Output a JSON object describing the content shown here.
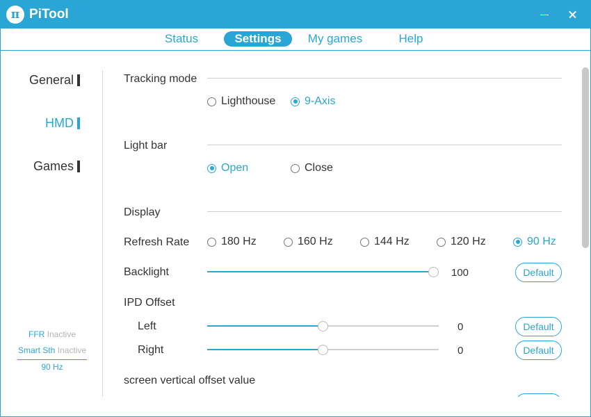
{
  "window": {
    "title": "PiTool",
    "logo_glyph": "π",
    "accent_color": "#2aa6d6"
  },
  "tabs": [
    {
      "label": "Status",
      "active": false
    },
    {
      "label": "Settings",
      "active": true
    },
    {
      "label": "My games",
      "active": false
    },
    {
      "label": "Help",
      "active": false
    }
  ],
  "sidebar": {
    "items": [
      {
        "label": "General",
        "active": false
      },
      {
        "label": "HMD",
        "active": true
      },
      {
        "label": "Games",
        "active": false
      }
    ],
    "status": {
      "ffr_label": "FFR",
      "ffr_value": "Inactive",
      "smart_label": "Smart Sth",
      "smart_value": "Inactive",
      "rate": "90 Hz"
    }
  },
  "settings": {
    "tracking": {
      "title": "Tracking mode",
      "options": [
        "Lighthouse",
        "9-Axis"
      ],
      "selected": "9-Axis"
    },
    "lightbar": {
      "title": "Light bar",
      "options": [
        "Open",
        "Close"
      ],
      "selected": "Open"
    },
    "display": {
      "title": "Display",
      "refresh_label": "Refresh Rate",
      "refresh_options": [
        "180 Hz",
        "160 Hz",
        "144 Hz",
        "120 Hz",
        "90 Hz"
      ],
      "refresh_selected": "90 Hz",
      "backlight_label": "Backlight",
      "backlight_value": "100",
      "backlight_fraction": 1.0,
      "default_label": "Default"
    },
    "ipd": {
      "title": "IPD Offset",
      "left_label": "Left",
      "left_value": "0",
      "left_fraction": 0.5,
      "right_label": "Right",
      "right_value": "0",
      "right_fraction": 0.5,
      "default_label": "Default"
    },
    "vertical_offset": {
      "title": "screen vertical offset value"
    }
  }
}
